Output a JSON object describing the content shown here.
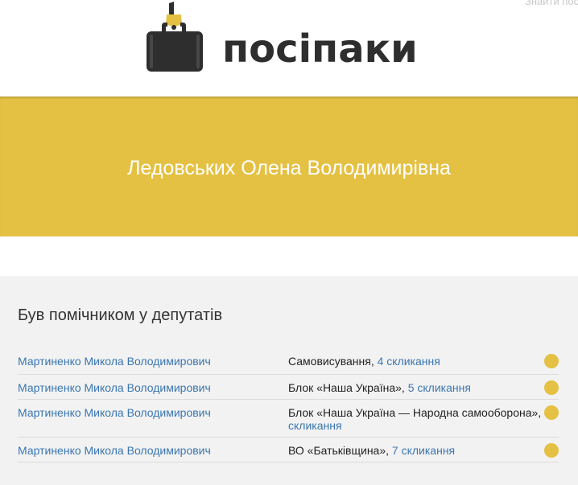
{
  "header": {
    "search_hint": "Знайти пос",
    "logo_text": "посіпаки"
  },
  "banner": {
    "person_name": "Ледовських Олена Володимирівна"
  },
  "section": {
    "title": "Був помічником у депутатів",
    "rows": [
      {
        "deputy": "Мартиненко Микола Володимирович",
        "faction": "Самовисування",
        "separator": ", ",
        "convocation": "4 скликання"
      },
      {
        "deputy": "Мартиненко Микола Володимирович",
        "faction": "Блок «Наша Україна»",
        "separator": ", ",
        "convocation": "5 скликання"
      },
      {
        "deputy": "Мартиненко Микола Володимирович",
        "faction": "Блок «Наша Україна — Народна самооборона»",
        "separator": ",",
        "convocation": "скликання"
      },
      {
        "deputy": "Мартиненко Микола Володимирович",
        "faction": "ВО «Батьківщина»",
        "separator": ", ",
        "convocation": "7 скликання"
      }
    ]
  },
  "colors": {
    "accent": "#e4c143",
    "link": "#3a76b0",
    "logo_dark": "#2e2e2e"
  }
}
